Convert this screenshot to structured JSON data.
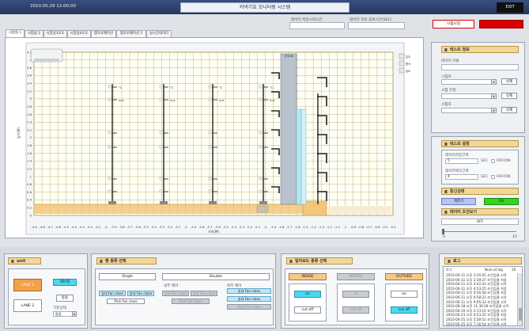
{
  "header": {
    "datetime": "2010.05.29 12:00:00",
    "title": "커넥기호 모니터링 시스템",
    "exit_label": "EXIT"
  },
  "top_fields": {
    "current_time_label": "데이터 저장시작시간",
    "start_time_label": "데이터 저장 종료시간(SEC)",
    "start_button": "시험시작",
    "stop_button": ""
  },
  "tabs": [
    "시험실 1",
    "시험실 2",
    "시험실3조도",
    "시험실4조도",
    "챔프로웨어산",
    "챔프로웨어산 2",
    "실시간데이터"
  ],
  "chart_data": {
    "type": "line",
    "xlabel": "거리(M)",
    "ylabel": "높이(M)",
    "x_ticks": [
      "-4.9",
      "-4.8",
      "-4.7",
      "-4.6",
      "-4.5",
      "-4.4",
      "-4.3",
      "-4.2",
      "-4.1",
      "-4",
      "-3.9",
      "-3.8",
      "-3.7",
      "-3.6",
      "-3.5",
      "-3.4",
      "-3.3",
      "-3.2",
      "-3.1",
      "-3",
      "-2.9",
      "-2.8",
      "-2.7",
      "-2.6",
      "-2.5",
      "-2.4",
      "-2.3",
      "-2.2",
      "-2.1",
      "-2",
      "-1.9",
      "-1.8",
      "-1.7",
      "-1.6",
      "-1.5",
      "-1.4",
      "-1.3",
      "-1.2",
      "-1.1",
      "-1",
      "-0.9",
      "-0.8",
      "-0.7",
      "-0.6",
      "-0.5",
      "-0.4"
    ],
    "y_ticks": [
      "4.2",
      "4",
      "3.8",
      "3.6",
      "3.4",
      "3.2",
      "3",
      "2.8",
      "2.6",
      "2.4",
      "2.2",
      "2",
      "1.8",
      "1.6",
      "1.4",
      "1.2",
      "1",
      "0.8",
      "0.6",
      "0.4",
      "0.2",
      "0"
    ],
    "sensor_units": [
      "°C",
      "m/s"
    ],
    "pole_label": "ETJUN",
    "legend": [
      "온도",
      "풍속",
      "습도"
    ]
  },
  "test_info": {
    "title": "테스트 정보",
    "data_name_label": "데이터 이름",
    "tester_label": "시험자",
    "test_type_label": "시험 유형",
    "test_room_label": "시험자",
    "buttons": [
      "삭제",
      "삭제",
      "삭제"
    ]
  },
  "test_settings": {
    "title": "테스트 설정",
    "save_interval_label": "데이터저장간격",
    "save_interval_value": "5",
    "save_interval_unit": "SEC",
    "option1": "OFF/ON",
    "check_interval_label": "데이터체크간격",
    "check_interval_value": "4",
    "check_interval_unit": "SEC",
    "option2": "OFF/ON"
  },
  "comm_status": {
    "title": "통신상태",
    "left_button": "계측기",
    "right_button": "OK"
  },
  "data_view": {
    "title": "데이터 조건보기",
    "field_value": "OFF",
    "slider_min": "0",
    "slider_max": "10"
  },
  "bottom_left": {
    "title": "unit",
    "left_options": [
      "LANE 1",
      "LANE 2"
    ],
    "right_buttons": [
      "제어정",
      "동동"
    ],
    "reference_label": "기본상태",
    "reference_value": "동동"
  },
  "bottom_mid": {
    "title": "팬 종류 선택",
    "mode_single": "Single",
    "mode_double": "Double",
    "sub_label_left": "내부 제어",
    "sub_label_right": "외부 제어",
    "left_buttons": [
      "실내 fan close",
      "실내 Fan close",
      "Pink Fan close"
    ],
    "middle_buttons": [
      "실내 Fan close",
      "실내 Fan close",
      "Pink Fan close"
    ],
    "right_buttons": [
      "실내 Fan close",
      "실내 Fan close",
      "Pink Fan close"
    ]
  },
  "bottom_right_mid": {
    "title": "일러보드 종류 선택",
    "heads": [
      "INSIDE",
      "MIDDLE",
      "OUTSIDE"
    ],
    "col1": [
      "on",
      "cut off"
    ],
    "col2": [
      "on",
      "cut off"
    ],
    "col3": [
      "on",
      "cut off"
    ]
  },
  "log": {
    "title": "로그",
    "num_label": "Num of log",
    "num_value": "20",
    "header": "로그",
    "entries": [
      "2010-06-11 오후 3:35:01 조건검결 시작",
      "2010-06-11 오후 3:39:27 조건검결 저장",
      "2010-06-11 오후 4:42:43 조건검결 시작",
      "2010-06-11 오후 4:53:25 조건검결 저장",
      "2010-06-11 오후 4:56:58 조건검결 저장",
      "2010-06-11 오후 6:58:21 조건검결 시작",
      "2010-06-11 오후 9:05:33 조건검결 시작",
      "2010-06-18 오전 11:39:28 조건검결 시작",
      "2010-06-19 오후 2:13:10 조건검결 시작",
      "2010-06-23 오후 4:53:25 조건검결 저장",
      "2010-06-25 오후 5:58:52 조건검결 시작",
      "2010-06-25 오후 7:16:54 조건검결 시작"
    ]
  },
  "colors": {
    "accent_red": "#d90000",
    "grid": "#a29a3c",
    "ground": "#f2c77c"
  }
}
